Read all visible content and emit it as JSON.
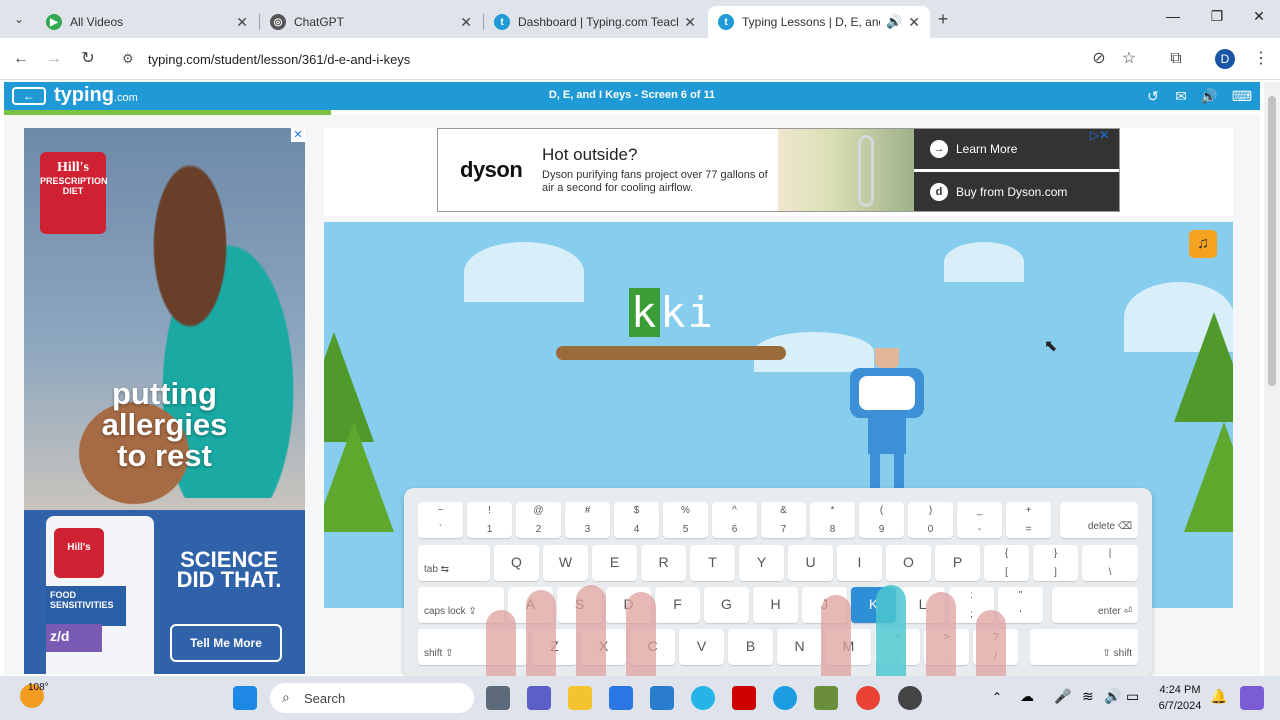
{
  "browser": {
    "tabs": [
      {
        "title": "All Videos",
        "color": "#34a853"
      },
      {
        "title": "ChatGPT",
        "color": "#555555"
      },
      {
        "title": "Dashboard | Typing.com Teache",
        "color": "#1f9ad7"
      },
      {
        "title": "Typing Lessons | D, E, and I",
        "color": "#1f9ad7"
      }
    ],
    "url": "typing.com/student/lesson/361/d-e-and-i-keys",
    "profile_initial": "D"
  },
  "typing_header": {
    "logo": "typing",
    "logo_suffix": ".com",
    "screen_title": "D, E, and I Keys - Screen 6 of 11",
    "progress_fraction": 0.26
  },
  "left_ad": {
    "brand": "Hill's",
    "brand_sub": "PRESCRIPTION DIET",
    "headline": [
      "putting",
      "allergies",
      "to rest"
    ],
    "bag_food": "FOOD SENSITIVITIES",
    "bag_product": "z/d",
    "tagline": [
      "SCIENCE",
      "DID THAT."
    ],
    "cta": "Tell Me More"
  },
  "top_ad": {
    "brand": "dyson",
    "headline": "Hot outside?",
    "body": "Dyson purifying fans project over 77 gallons of air a second for cooling airflow.",
    "btn1": "Learn More",
    "btn2": "Buy from Dyson.com"
  },
  "game": {
    "current_char": "k",
    "rest_chars": "ki",
    "active_key": "K"
  },
  "keyboard": {
    "row1": [
      {
        "top": "~",
        "bot": "`"
      },
      {
        "top": "!",
        "bot": "1"
      },
      {
        "top": "@",
        "bot": "2"
      },
      {
        "top": "#",
        "bot": "3"
      },
      {
        "top": "$",
        "bot": "4"
      },
      {
        "top": "%",
        "bot": "5"
      },
      {
        "top": "^",
        "bot": "6"
      },
      {
        "top": "&",
        "bot": "7"
      },
      {
        "top": "*",
        "bot": "8"
      },
      {
        "top": "(",
        "bot": "9"
      },
      {
        "top": ")",
        "bot": "0"
      },
      {
        "top": "_",
        "bot": "-"
      },
      {
        "top": "+",
        "bot": "="
      }
    ],
    "delete": "delete ⌫",
    "tab": "tab ⇆",
    "row2": [
      "Q",
      "W",
      "E",
      "R",
      "T",
      "Y",
      "U",
      "I",
      "O",
      "P"
    ],
    "row2_sym": [
      {
        "top": "{",
        "bot": "["
      },
      {
        "top": "}",
        "bot": "]"
      },
      {
        "top": "|",
        "bot": "\\"
      }
    ],
    "caps": "caps lock ⇪",
    "row3": [
      "A",
      "S",
      "D",
      "F",
      "G",
      "H",
      "J",
      "K",
      "L"
    ],
    "row3_sym": [
      {
        "top": ":",
        "bot": ";"
      },
      {
        "top": "\"",
        "bot": "'"
      }
    ],
    "enter": "enter ⏎",
    "shift_left": "shift ⇧",
    "row4": [
      "Z",
      "X",
      "C",
      "V",
      "B",
      "N",
      "M"
    ],
    "row4_sym": [
      {
        "top": "<",
        "bot": ","
      },
      {
        "top": ">",
        "bot": "."
      },
      {
        "top": "?",
        "bot": "/"
      }
    ],
    "shift_right": "⇧ shift"
  },
  "taskbar": {
    "temperature": "108°",
    "search_placeholder": "Search",
    "time": "4:24 PM",
    "date": "6/7/2024"
  }
}
